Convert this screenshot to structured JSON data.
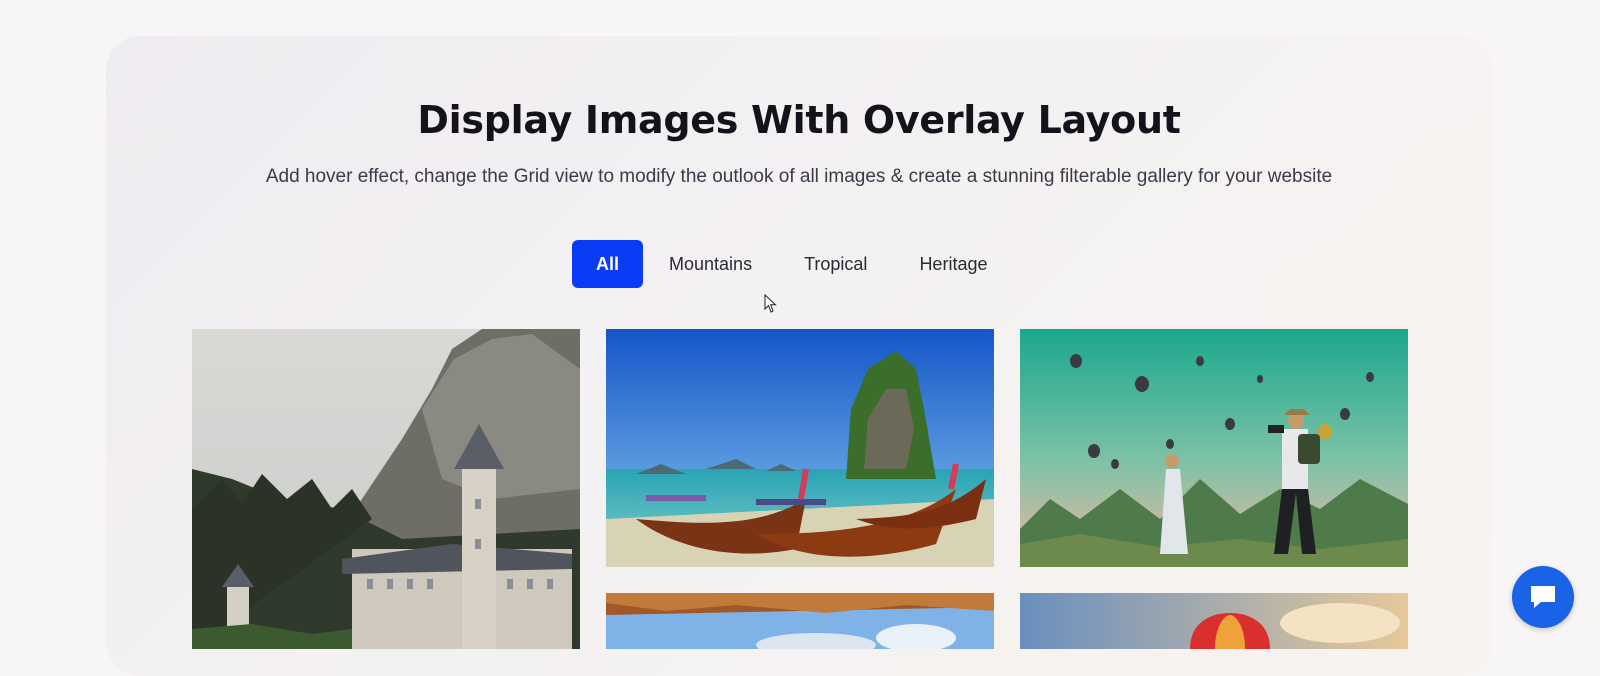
{
  "section": {
    "title": "Display Images With Overlay Layout",
    "subtitle": "Add hover effect, change the Grid view to modify the outlook of all images & create a stunning filterable gallery for your website"
  },
  "filters": [
    {
      "label": "All",
      "active": true
    },
    {
      "label": "Mountains",
      "active": false
    },
    {
      "label": "Tropical",
      "active": false
    },
    {
      "label": "Heritage",
      "active": false
    }
  ],
  "gallery": [
    {
      "name": "castle-mountain-image",
      "category": "Heritage"
    },
    {
      "name": "tropical-boats-image",
      "category": "Tropical"
    },
    {
      "name": "balloons-travelers-image",
      "category": "Mountains"
    },
    {
      "name": "tropical-beach-hut-image",
      "category": "Tropical"
    },
    {
      "name": "hot-air-balloon-image",
      "category": "Mountains"
    }
  ],
  "colors": {
    "accent": "#0a3cf5",
    "chat": "#1a63e6"
  },
  "icons": {
    "cursor": "mouse-pointer-icon",
    "chat": "chat-bubble-icon"
  }
}
